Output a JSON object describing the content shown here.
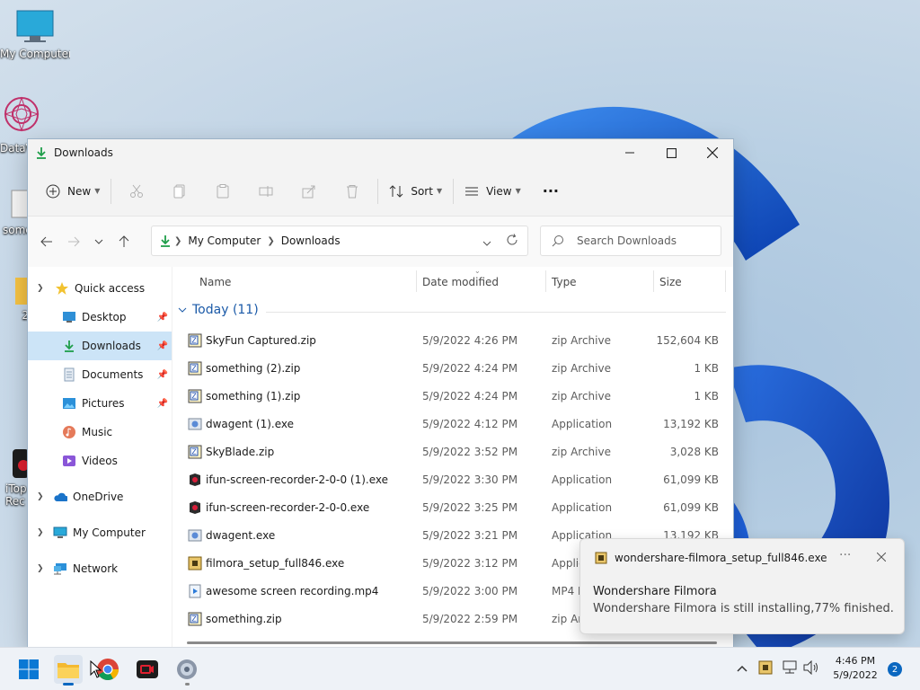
{
  "desktop": {
    "icons": [
      {
        "label": "My Computer"
      },
      {
        "label": "DataV"
      },
      {
        "label": "some"
      },
      {
        "label": "2"
      },
      {
        "label": "iTop Rec"
      }
    ]
  },
  "window": {
    "title": "Downloads",
    "toolbar": {
      "new_label": "New",
      "sort_label": "Sort",
      "view_label": "View"
    },
    "address": {
      "crumbs": [
        "My Computer",
        "Downloads"
      ]
    },
    "search": {
      "placeholder": "Search Downloads"
    },
    "sidebar": {
      "quick_access": "Quick access",
      "items": [
        {
          "label": "Desktop"
        },
        {
          "label": "Downloads"
        },
        {
          "label": "Documents"
        },
        {
          "label": "Pictures"
        },
        {
          "label": "Music"
        },
        {
          "label": "Videos"
        }
      ],
      "onedrive": "OneDrive",
      "my_computer": "My Computer",
      "network": "Network"
    },
    "columns": {
      "name": "Name",
      "date": "Date modified",
      "type": "Type",
      "size": "Size"
    },
    "group_label": "Today (11)",
    "files": [
      {
        "name": "SkyFun Captured.zip",
        "date": "5/9/2022 4:26 PM",
        "type": "zip Archive",
        "size": "152,604 KB",
        "icon": "zip-icon"
      },
      {
        "name": "something (2).zip",
        "date": "5/9/2022 4:24 PM",
        "type": "zip Archive",
        "size": "1 KB",
        "icon": "zip-icon"
      },
      {
        "name": "something (1).zip",
        "date": "5/9/2022 4:24 PM",
        "type": "zip Archive",
        "size": "1 KB",
        "icon": "zip-icon"
      },
      {
        "name": "dwagent (1).exe",
        "date": "5/9/2022 4:12 PM",
        "type": "Application",
        "size": "13,192 KB",
        "icon": "app-icon"
      },
      {
        "name": "SkyBlade.zip",
        "date": "5/9/2022 3:52 PM",
        "type": "zip Archive",
        "size": "3,028 KB",
        "icon": "zip-icon"
      },
      {
        "name": "ifun-screen-recorder-2-0-0 (1).exe",
        "date": "5/9/2022 3:30 PM",
        "type": "Application",
        "size": "61,099 KB",
        "icon": "recorder-icon"
      },
      {
        "name": "ifun-screen-recorder-2-0-0.exe",
        "date": "5/9/2022 3:25 PM",
        "type": "Application",
        "size": "61,099 KB",
        "icon": "recorder-icon"
      },
      {
        "name": "dwagent.exe",
        "date": "5/9/2022 3:21 PM",
        "type": "Application",
        "size": "13,192 KB",
        "icon": "app-icon"
      },
      {
        "name": "filmora_setup_full846.exe",
        "date": "5/9/2022 3:12 PM",
        "type": "Applic",
        "size": "",
        "icon": "installer-icon"
      },
      {
        "name": "awesome screen recording.mp4",
        "date": "5/9/2022 3:00 PM",
        "type": "MP4 F",
        "size": "",
        "icon": "video-file-icon"
      },
      {
        "name": "something.zip",
        "date": "5/9/2022 2:59 PM",
        "type": "zip Ar",
        "size": "",
        "icon": "zip-icon"
      }
    ]
  },
  "toast": {
    "app": "wondershare-filmora_setup_full846.exe",
    "title": "Wondershare Filmora",
    "message": "Wondershare Filmora is still installing,77% finished."
  },
  "taskbar": {
    "time": "4:46 PM",
    "date": "5/9/2022",
    "notifications": "2"
  },
  "colors": {
    "accent": "#0067c0",
    "selection": "#cce4f7",
    "group": "#1b5aa8"
  }
}
